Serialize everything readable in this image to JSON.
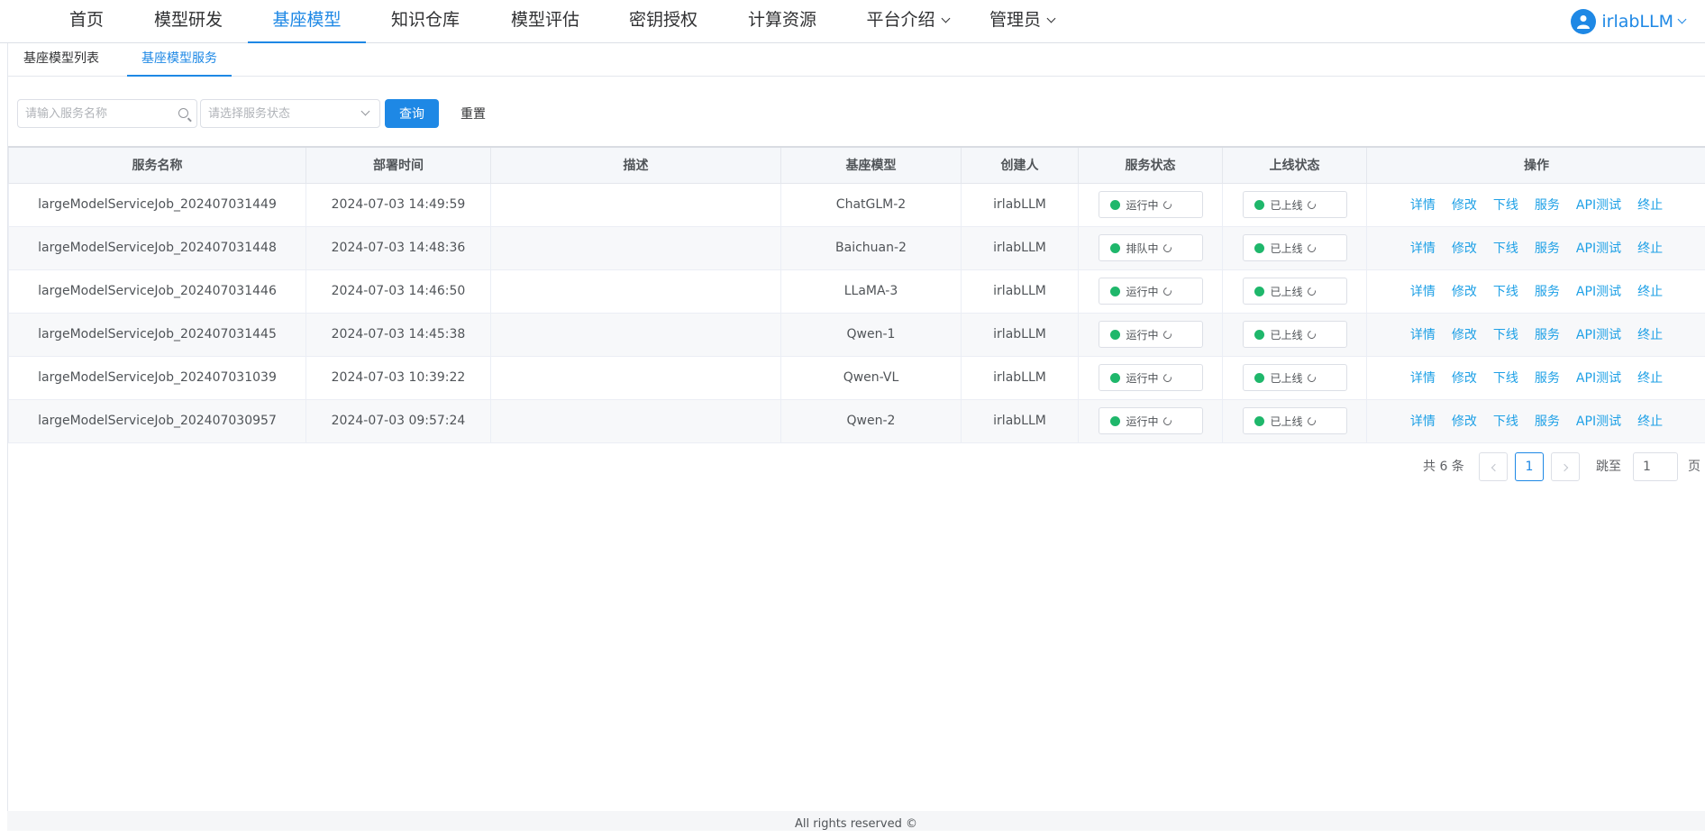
{
  "nav": {
    "items": [
      {
        "label": "首页"
      },
      {
        "label": "模型研发"
      },
      {
        "label": "基座模型"
      },
      {
        "label": "知识仓库"
      },
      {
        "label": "模型评估"
      },
      {
        "label": "密钥授权"
      },
      {
        "label": "计算资源"
      },
      {
        "label": "平台介绍"
      },
      {
        "label": "管理员"
      }
    ],
    "active_index": 2,
    "user": "irlabLLM"
  },
  "subtabs": [
    "基座模型列表",
    "基座模型服务"
  ],
  "filter": {
    "name_placeholder": "请输入服务名称",
    "status_placeholder": "请选择服务状态",
    "query_label": "查询",
    "reset_label": "重置"
  },
  "table": {
    "headers": [
      "服务名称",
      "部署时间",
      "描述",
      "基座模型",
      "创建人",
      "服务状态",
      "上线状态",
      "操作"
    ],
    "rows": [
      {
        "name": "largeModelServiceJob_202407031449",
        "time": "2024-07-03 14:49:59",
        "desc": "",
        "model": "ChatGLM-2",
        "creator": "irlabLLM",
        "status": "运行中",
        "online": "已上线"
      },
      {
        "name": "largeModelServiceJob_202407031448",
        "time": "2024-07-03 14:48:36",
        "desc": "",
        "model": "Baichuan-2",
        "creator": "irlabLLM",
        "status": "排队中",
        "online": "已上线"
      },
      {
        "name": "largeModelServiceJob_202407031446",
        "time": "2024-07-03 14:46:50",
        "desc": "",
        "model": "LLaMA-3",
        "creator": "irlabLLM",
        "status": "运行中",
        "online": "已上线"
      },
      {
        "name": "largeModelServiceJob_202407031445",
        "time": "2024-07-03 14:45:38",
        "desc": "",
        "model": "Qwen-1",
        "creator": "irlabLLM",
        "status": "运行中",
        "online": "已上线"
      },
      {
        "name": "largeModelServiceJob_202407031039",
        "time": "2024-07-03 10:39:22",
        "desc": "",
        "model": "Qwen-VL",
        "creator": "irlabLLM",
        "status": "运行中",
        "online": "已上线"
      },
      {
        "name": "largeModelServiceJob_202407030957",
        "time": "2024-07-03 09:57:24",
        "desc": "",
        "model": "Qwen-2",
        "creator": "irlabLLM",
        "status": "运行中",
        "online": "已上线"
      }
    ],
    "ops": [
      "详情",
      "修改",
      "下线",
      "服务",
      "API测试",
      "终止"
    ]
  },
  "pager": {
    "total": "共 6 条",
    "current": "1",
    "jump_label": "跳至",
    "jump_value": "1",
    "page_label": "页"
  },
  "footer": "All rights reserved ©"
}
